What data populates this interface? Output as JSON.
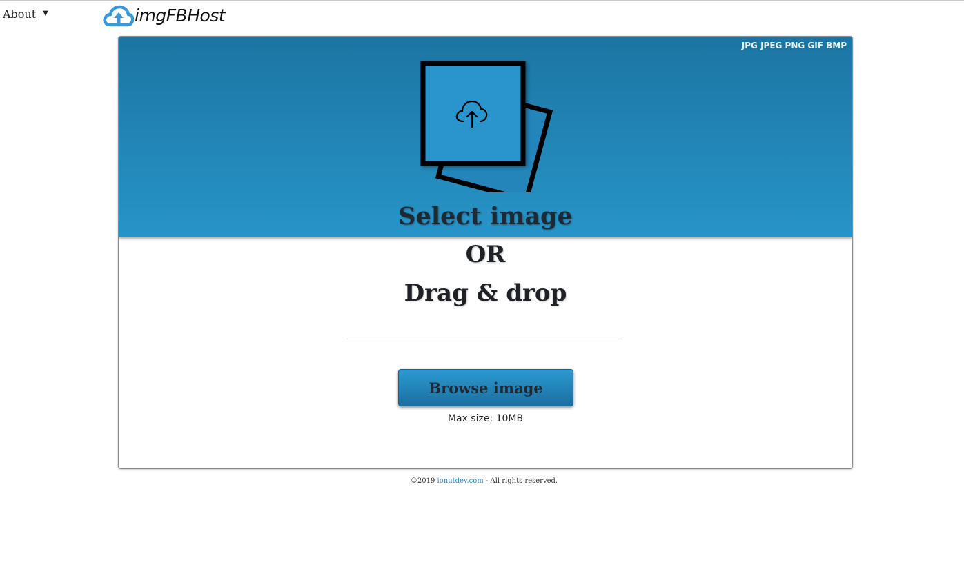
{
  "nav": {
    "about_label": "About",
    "caret": "▼"
  },
  "logo": {
    "text": "imgFBHost",
    "icon": "cloud-upload-icon",
    "color": "#3a9ad9"
  },
  "upload": {
    "formats": "JPG JPEG PNG GIF BMP",
    "select_label": "Select image",
    "or_label": "OR",
    "drag_label": "Drag & drop",
    "browse_label": "Browse image",
    "max_size": "Max size: 10MB",
    "accent": "#2794c8"
  },
  "footer": {
    "prefix": "©2019 ",
    "link_text": "ionutdev.com",
    "suffix": " - All rights reserved."
  }
}
